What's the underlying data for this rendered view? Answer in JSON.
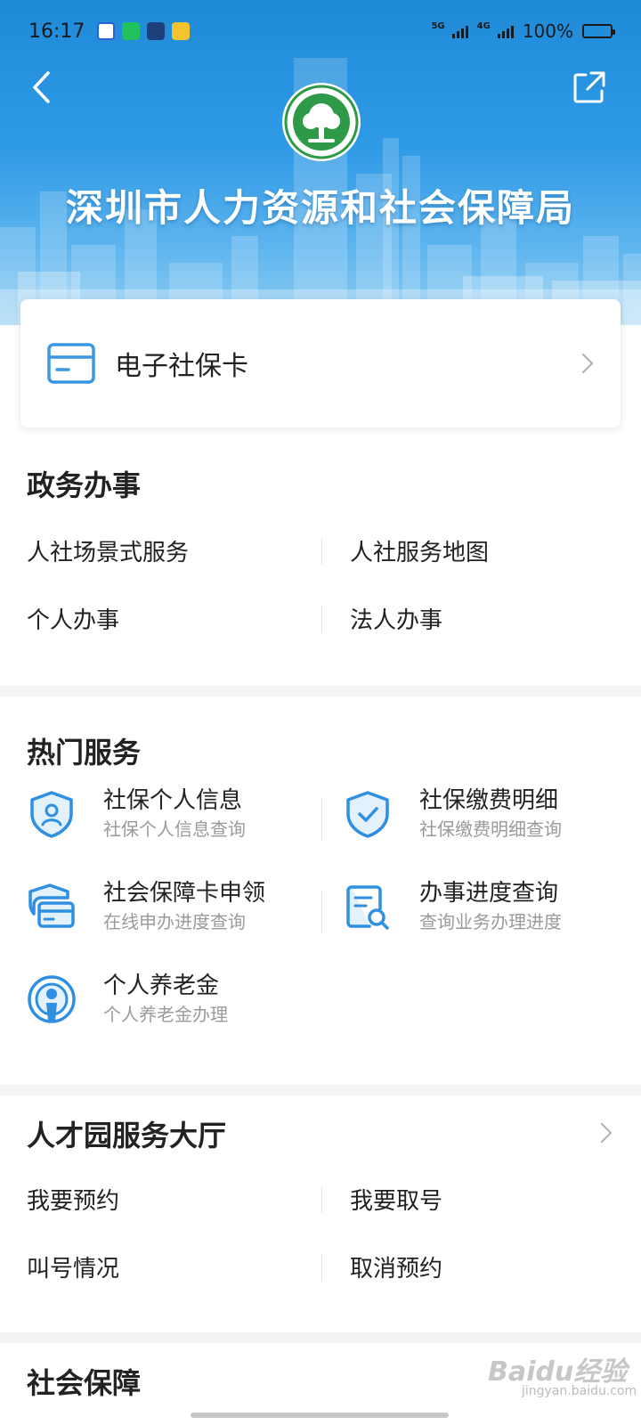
{
  "status_bar": {
    "time": "16:17",
    "network_1": "5G",
    "network_2": "4G",
    "battery": "100%"
  },
  "header": {
    "title": "深圳市人力资源和社会保障局",
    "back_icon": "chevron-left-icon",
    "share_icon": "share-icon"
  },
  "card": {
    "label": "电子社保卡",
    "icon": "card-icon"
  },
  "gov_affairs": {
    "title": "政务办事",
    "links": [
      "人社场景式服务",
      "人社服务地图",
      "个人办事",
      "法人办事"
    ]
  },
  "hot_services": {
    "title": "热门服务",
    "items": [
      {
        "title": "社保个人信息",
        "subtitle": "社保个人信息查询",
        "icon": "shield-person-icon"
      },
      {
        "title": "社保缴费明细",
        "subtitle": "社保缴费明细查询",
        "icon": "shield-check-icon"
      },
      {
        "title": "社会保障卡申领",
        "subtitle": "在线申办进度查询",
        "icon": "card-shield-icon"
      },
      {
        "title": "办事进度查询",
        "subtitle": "查询业务办理进度",
        "icon": "document-search-icon"
      },
      {
        "title": "个人养老金",
        "subtitle": "个人养老金办理",
        "icon": "pension-icon"
      }
    ]
  },
  "talent_hall": {
    "title": "人才园服务大厅",
    "links": [
      "我要预约",
      "我要取号",
      "叫号情况",
      "取消预约"
    ]
  },
  "social_security": {
    "title": "社会保障"
  },
  "watermark": {
    "text": "Baidu经验",
    "sub": "jingyan.baidu.com"
  },
  "colors": {
    "accent": "#2f8fe0",
    "banner": "#2f9ae6"
  }
}
